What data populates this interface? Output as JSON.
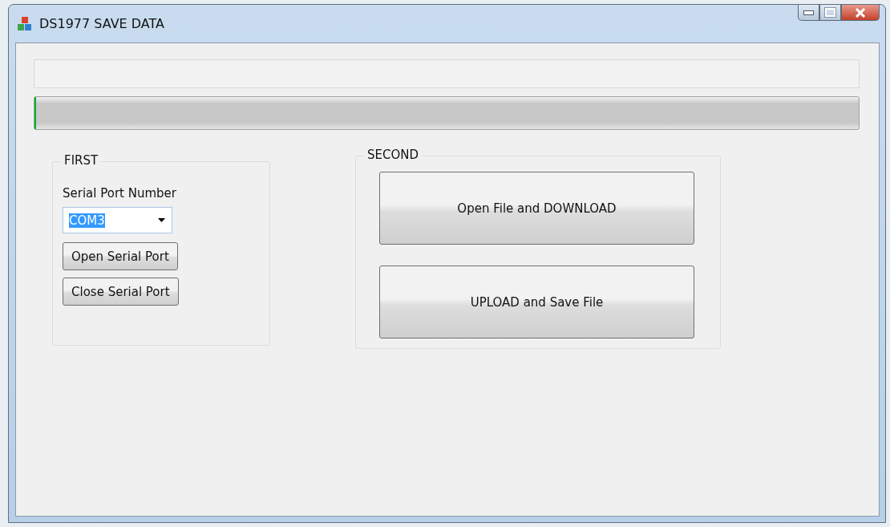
{
  "window": {
    "title": "DS1977 SAVE DATA"
  },
  "progress": {
    "level": 0
  },
  "first": {
    "title": "FIRST",
    "port_label": "Serial Port Number",
    "port": {
      "value": "COM3",
      "highlighted": true
    },
    "buttons": [
      "Open Serial Port",
      "Close Serial Port"
    ]
  },
  "second": {
    "title": "SECOND",
    "buttons": [
      "Open File and DOWNLOAD",
      "UPLOAD and Save File"
    ]
  }
}
